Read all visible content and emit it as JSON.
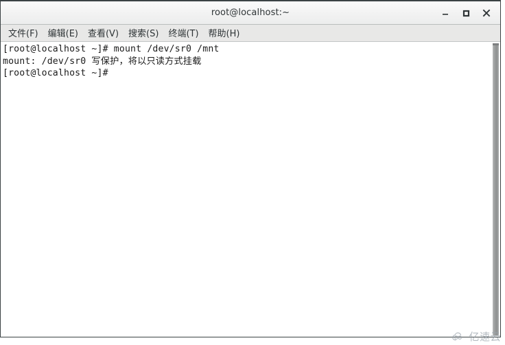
{
  "window": {
    "title": "root@localhost:~",
    "controls": [
      {
        "name": "minimize",
        "label": "–"
      },
      {
        "name": "maximize",
        "label": "□"
      },
      {
        "name": "close",
        "label": "✕"
      }
    ]
  },
  "menubar": {
    "items": [
      {
        "label": "文件(F)"
      },
      {
        "label": "编辑(E)"
      },
      {
        "label": "查看(V)"
      },
      {
        "label": "搜索(S)"
      },
      {
        "label": "终端(T)"
      },
      {
        "label": "帮助(H)"
      }
    ]
  },
  "terminal": {
    "lines": [
      "[root@localhost ~]# mount /dev/sr0 /mnt",
      "mount: /dev/sr0 写保护，将以只读方式挂载",
      "[root@localhost ~]# "
    ],
    "foreground_color": "#1b1b1b",
    "background_color": "#ffffff"
  },
  "scrollbar": {
    "orientation": "vertical",
    "thumb_color": "#9a9c9c"
  },
  "watermark": {
    "text": "亿速云",
    "icon": "cloud-icon",
    "color": "#9aa3ab"
  }
}
